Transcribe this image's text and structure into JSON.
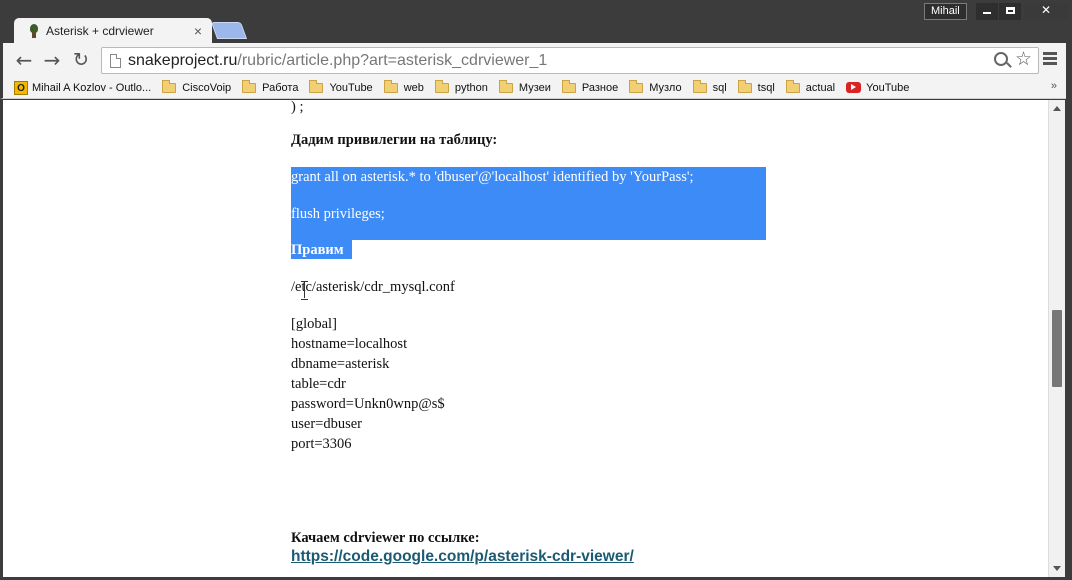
{
  "window": {
    "user_label": "Mihail"
  },
  "tab": {
    "title": "Asterisk + cdrviewer",
    "close_glyph": "×"
  },
  "toolbar": {
    "back_glyph": "←",
    "forward_glyph": "→",
    "reload_glyph": "↻",
    "star_glyph": "☆"
  },
  "address_bar": {
    "host": "snakeproject.ru",
    "path": "/rubric/article.php?art=asterisk_cdrviewer_1"
  },
  "bookmarks": [
    {
      "label": "Mihail A Kozlov - Outlo...",
      "icon": "outlook-icon"
    },
    {
      "label": "CiscoVoip",
      "icon": "folder-icon"
    },
    {
      "label": "Работа",
      "icon": "folder-icon"
    },
    {
      "label": "YouTube",
      "icon": "folder-icon"
    },
    {
      "label": "web",
      "icon": "folder-icon"
    },
    {
      "label": "python",
      "icon": "folder-icon"
    },
    {
      "label": "Музеи",
      "icon": "folder-icon"
    },
    {
      "label": "Разное",
      "icon": "folder-icon"
    },
    {
      "label": "Музло",
      "icon": "folder-icon"
    },
    {
      "label": "sql",
      "icon": "folder-icon"
    },
    {
      "label": "tsql",
      "icon": "folder-icon"
    },
    {
      "label": "actual",
      "icon": "folder-icon"
    },
    {
      "label": "YouTube",
      "icon": "youtube-icon"
    }
  ],
  "bookmarks_more": "»",
  "article": {
    "top_fragment": ") ;",
    "privileges_heading": "Дадим привилегии на таблицу:",
    "grant_line": "grant all on asterisk.* to 'dbuser'@'localhost' identified by 'YourPass';",
    "flush_line": "flush privileges;",
    "edit_heading": "Правим",
    "config_path": "/etc/asterisk/cdr_mysql.conf",
    "config_lines": [
      "[global]",
      "hostname=localhost",
      "dbname=asterisk",
      "table=cdr",
      "password=Unkn0wnp@s$",
      "user=dbuser",
      "port=3306"
    ],
    "download_heading": "Качаем cdrviewer по ссылке:",
    "download_link": "https://code.google.com/p/asterisk-cdr-viewer/"
  }
}
